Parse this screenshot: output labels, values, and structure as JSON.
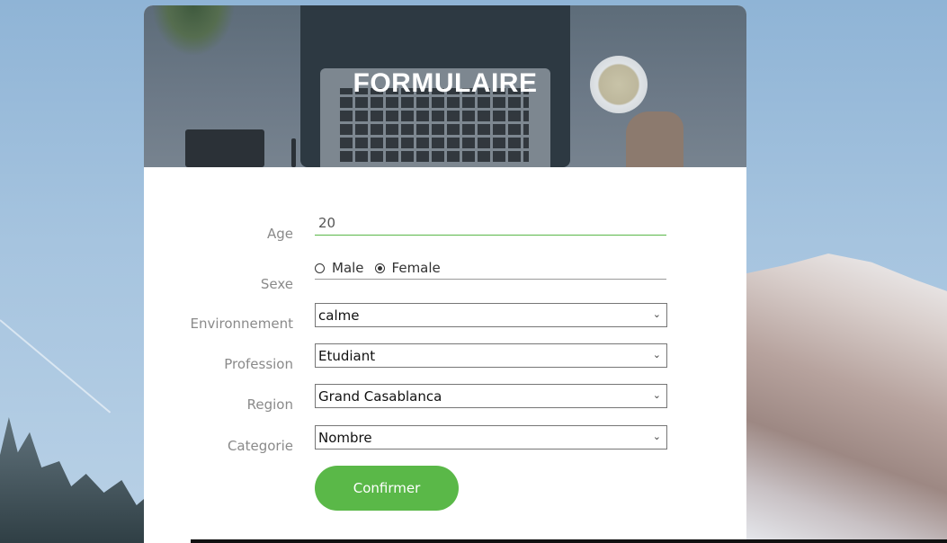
{
  "header": {
    "title": "FORMULAIRE"
  },
  "form": {
    "age": {
      "label": "Age",
      "value": "20"
    },
    "sexe": {
      "label": "Sexe",
      "options": [
        {
          "label": "Male",
          "checked": false
        },
        {
          "label": "Female",
          "checked": true
        }
      ]
    },
    "environnement": {
      "label": "Environnement",
      "value": "calme"
    },
    "profession": {
      "label": "Profession",
      "value": "Etudiant"
    },
    "region": {
      "label": "Region",
      "value": "Grand Casablanca"
    },
    "categorie": {
      "label": "Categorie",
      "value": "Nombre"
    },
    "submit_label": "Confirmer"
  },
  "colors": {
    "accent": "#5ab848",
    "label": "#8a8a8a"
  }
}
